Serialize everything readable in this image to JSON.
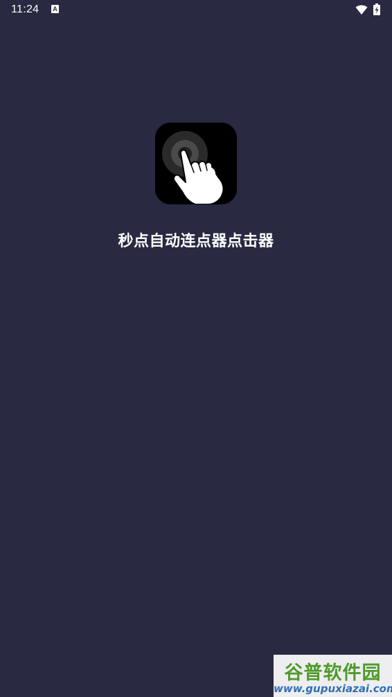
{
  "status_bar": {
    "time": "11:24",
    "notification_icon": "a-text-icon",
    "notification_letter": "A",
    "wifi_icon": "wifi-icon",
    "battery_icon": "battery-charging-icon"
  },
  "splash": {
    "app_icon": "tap-hand-icon",
    "app_name": "秒点自动连点器点击器"
  },
  "watermark": {
    "title": "谷普软件园",
    "url": "www.gupuxiazai.com"
  },
  "colors": {
    "background": "#292941",
    "icon_background": "#000000",
    "watermark_green": "#4f9a2a",
    "watermark_blue": "#2f6fb3"
  }
}
